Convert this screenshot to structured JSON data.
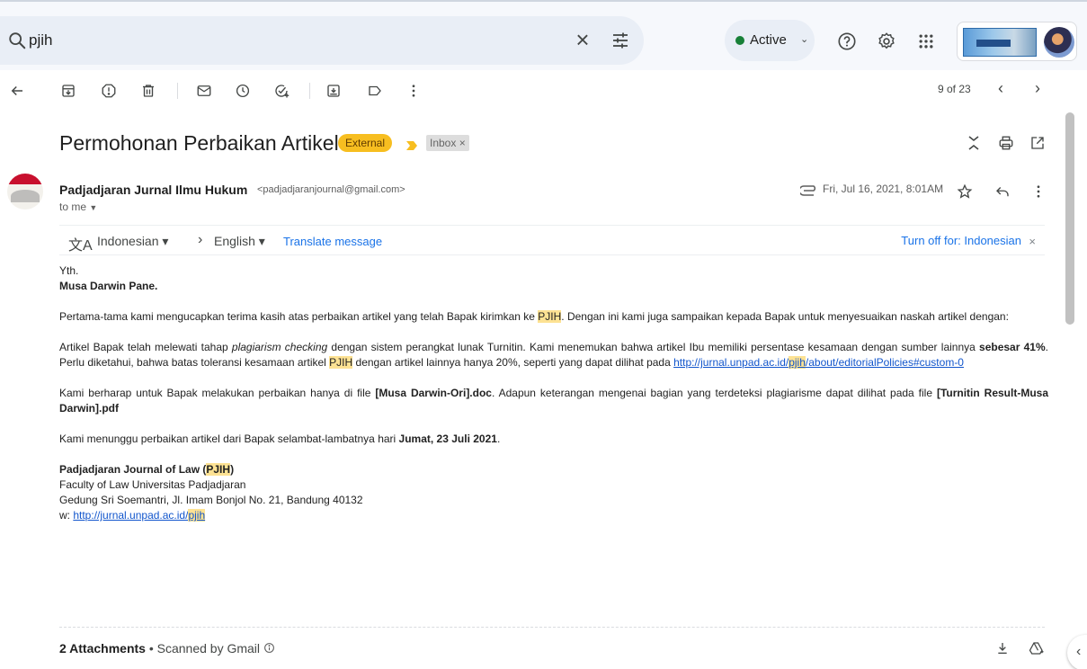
{
  "search": {
    "query": "pjih",
    "clear_icon": "close-icon",
    "options_icon": "tune-icon"
  },
  "status": {
    "label": "Active",
    "dot_color": "#188038"
  },
  "header_icons": [
    "help-icon",
    "settings-icon",
    "apps-grid-icon"
  ],
  "toolbar": {
    "icons": [
      "back-arrow-icon",
      "archive-icon",
      "report-spam-icon",
      "delete-icon",
      "mark-unread-icon",
      "snooze-icon",
      "add-task-icon",
      "move-to-icon",
      "label-icon",
      "more-vert-icon"
    ],
    "pager": "9 of 23"
  },
  "message": {
    "subject": "Permohonan Perbaikan Artikel",
    "external_badge": "External",
    "inbox_badge": "Inbox ×",
    "sender_name": "Padjadjaran Jurnal Ilmu Hukum",
    "sender_email": "<padjadjaranjournal@gmail.com>",
    "to_line": "to me",
    "date": "Fri, Jul 16, 2021, 8:01AM"
  },
  "translate": {
    "from_lang": "Indonesian",
    "to_lang": "English",
    "translate_link": "Translate message",
    "turn_off": "Turn off for: Indonesian"
  },
  "body": {
    "greeting": "Yth.",
    "recipient": "Musa Darwin Pane.",
    "p1_a": "Pertama-tama kami mengucapkan terima kasih atas perbaikan artikel yang telah Bapak kirimkan ke ",
    "p1_hl": "PJIH",
    "p1_b": ". Dengan ini kami juga sampaikan kepada Bapak untuk menyesuaikan naskah artikel dengan:",
    "p2_a": "Artikel Bapak telah melewati tahap ",
    "p2_em": "plagiarism checking",
    "p2_b": " dengan sistem perangkat lunak Turnitin. Kami menemukan bahwa artikel Ibu memiliki persentase kesamaan dengan sumber lainnya ",
    "p2_bold": "sebesar 41%",
    "p2_c": ". Perlu diketahui, bahwa batas toleransi kesamaan artikel ",
    "p2_hl": "PJIH",
    "p2_d": " dengan artikel lainnya hanya 20%, seperti yang dapat dilihat pada ",
    "p2_link_a": "http://jurnal.unpad.ac.id/",
    "p2_link_hl": "pjih",
    "p2_link_b": "/about/editorialPolicies#custom-0",
    "p3_a": "Kami berharap untuk Bapak melakukan perbaikan hanya di file ",
    "p3_bold1": "[Musa Darwin-Ori].doc",
    "p3_b": ". Adapun keterangan mengenai bagian yang terdeteksi plagiarisme dapat dilihat pada file ",
    "p3_bold2": "[Turnitin Result-Musa Darwin].pdf",
    "p4_a": "Kami menunggu perbaikan artikel dari Bapak selambat-lambatnya hari ",
    "p4_bold": "Jumat, 23 Juli 2021",
    "p4_b": ".",
    "sig_name_a": "Padjadjaran Journal of Law (",
    "sig_name_hl": "PJIH",
    "sig_name_b": ")",
    "sig_line2": "Faculty of Law Universitas Padjadjaran",
    "sig_line3": "Gedung Sri Soemantri, Jl. Imam Bonjol No. 21, Bandung 40132",
    "sig_web_prefix": "w: ",
    "sig_web_a": "http://jurnal.unpad.ac.id/",
    "sig_web_hl": "pjih"
  },
  "attachments": {
    "count_label": "2 Attachments",
    "scanned": " • Scanned by Gmail"
  },
  "colors": {
    "highlight": "#fde293",
    "external": "#f7be20",
    "link": "#1155cc"
  }
}
